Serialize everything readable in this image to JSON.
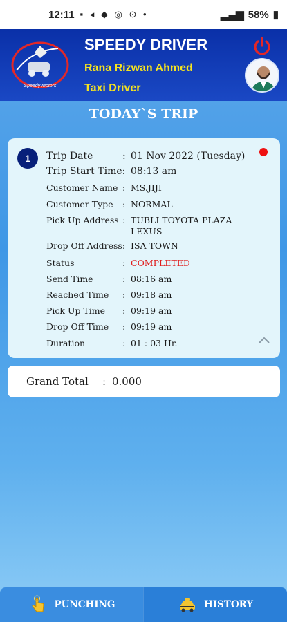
{
  "status_bar": {
    "time": "12:11",
    "battery": "58%"
  },
  "header": {
    "title": "SPEEDY DRIVER",
    "driver_name": "Rana Rizwan Ahmed",
    "driver_role": "Taxi Driver",
    "logo_text": "Speedy Motors"
  },
  "page_title": "TODAY`S TRIP",
  "trip": {
    "number": "1",
    "rows": [
      {
        "label": "Trip Date",
        "value": "01 Nov 2022 (Tuesday)"
      },
      {
        "label": "Trip Start Time:",
        "value": "08:13 am"
      },
      {
        "label": "Customer Name",
        "value": "MS.JIJI"
      },
      {
        "label": "Customer Type",
        "value": "NORMAL"
      },
      {
        "label": "Pick Up Address",
        "value": "TUBLI TOYOTA PLAZA LEXUS"
      },
      {
        "label": "Drop Off Address:",
        "value": "ISA TOWN"
      },
      {
        "label": "Status",
        "value": "COMPLETED"
      },
      {
        "label": "Send Time",
        "value": "08:16 am"
      },
      {
        "label": "Reached Time",
        "value": "09:18 am"
      },
      {
        "label": "Pick Up Time",
        "value": "09:19 am"
      },
      {
        "label": "Drop Off Time",
        "value": "09:19 am"
      },
      {
        "label": "Duration",
        "value": "01 : 03 Hr."
      }
    ],
    "status_color": "#e01b1b"
  },
  "total": {
    "label": "Grand Total",
    "value": "0.000"
  },
  "nav": {
    "punching": "PUNCHING",
    "history": "HISTORY"
  },
  "icons": [
    "power-icon",
    "hand-tap-icon",
    "taxi-icon",
    "chevron-up-icon"
  ]
}
